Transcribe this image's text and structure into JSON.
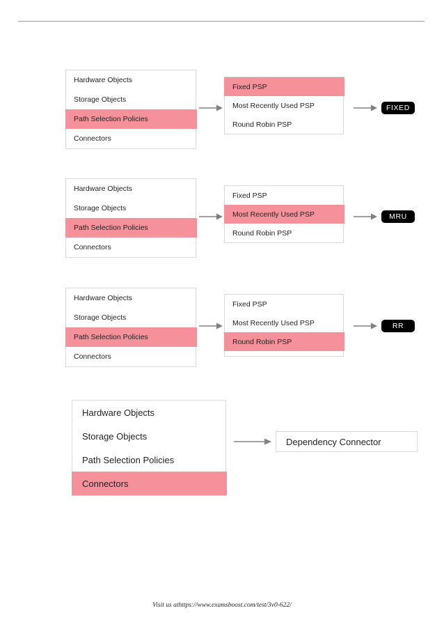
{
  "page": {
    "footer_text": "Visit us athttps://www.examsboost.com/test/3v0-622/"
  },
  "colors": {
    "highlight": "#f4919b",
    "badge_bg": "#000000",
    "badge_text": "#ffffff",
    "border": "#d8d8d8",
    "arrow": "#808080",
    "rule": "#9b9b9b"
  },
  "rows": [
    {
      "menu": {
        "items": [
          {
            "label": "Hardware Objects",
            "highlighted": false
          },
          {
            "label": "Storage Objects",
            "highlighted": false
          },
          {
            "label": "Path Selection Policies",
            "highlighted": true
          },
          {
            "label": "Connectors",
            "highlighted": false
          }
        ]
      },
      "psp": {
        "items": [
          {
            "label": "Fixed PSP",
            "highlighted": true
          },
          {
            "label": "Most Recently Used PSP",
            "highlighted": false
          },
          {
            "label": "Round Robin PSP",
            "highlighted": false
          }
        ]
      },
      "badge": {
        "label": "FIXED"
      }
    },
    {
      "menu": {
        "items": [
          {
            "label": "Hardware Objects",
            "highlighted": false
          },
          {
            "label": "Storage Objects",
            "highlighted": false
          },
          {
            "label": "Path Selection Policies",
            "highlighted": true
          },
          {
            "label": "Connectors",
            "highlighted": false
          }
        ]
      },
      "psp": {
        "items": [
          {
            "label": "Fixed PSP",
            "highlighted": false
          },
          {
            "label": "Most Recently Used PSP",
            "highlighted": true
          },
          {
            "label": "Round Robin PSP",
            "highlighted": false
          }
        ]
      },
      "badge": {
        "label": "MRU"
      }
    },
    {
      "menu": {
        "items": [
          {
            "label": "Hardware Objects",
            "highlighted": false
          },
          {
            "label": "Storage Objects",
            "highlighted": false
          },
          {
            "label": "Path Selection Policies",
            "highlighted": true
          },
          {
            "label": "Connectors",
            "highlighted": false
          }
        ]
      },
      "psp": {
        "items": [
          {
            "label": "Fixed PSP",
            "highlighted": false
          },
          {
            "label": "Most Recently Used PSP",
            "highlighted": false
          },
          {
            "label": "Round Robin PSP",
            "highlighted": true
          }
        ]
      },
      "badge": {
        "label": "RR"
      }
    }
  ],
  "bottom": {
    "menu": {
      "items": [
        {
          "label": "Hardware Objects",
          "highlighted": false
        },
        {
          "label": "Storage Objects",
          "highlighted": false
        },
        {
          "label": "Path Selection Policies",
          "highlighted": false
        },
        {
          "label": "Connectors",
          "highlighted": true
        }
      ]
    },
    "target": {
      "label": "Dependency Connector"
    }
  }
}
